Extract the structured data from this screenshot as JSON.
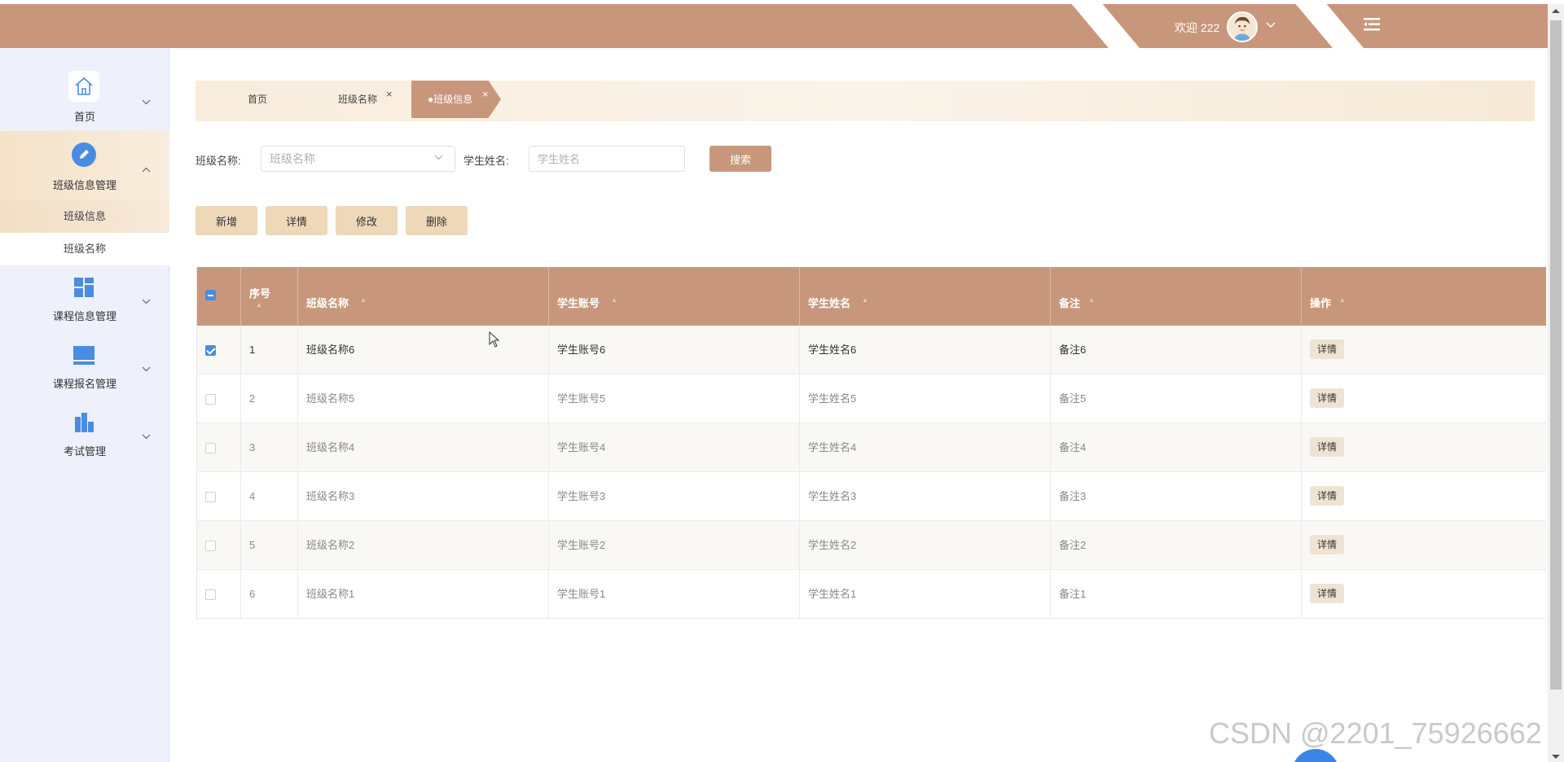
{
  "header": {
    "welcome": "欢迎 222",
    "colors": {
      "brand": "#c8977b",
      "sidebar_bg": "#eef0fc",
      "accent": "#efd8b8"
    }
  },
  "sidebar": {
    "items": [
      {
        "label": "首页",
        "icon": "home-icon"
      },
      {
        "label": "班级信息管理",
        "icon": "edit-icon",
        "expanded": true
      },
      {
        "label": "课程信息管理",
        "icon": "dashboard-icon"
      },
      {
        "label": "课程报名管理",
        "icon": "monitor-icon"
      },
      {
        "label": "考试管理",
        "icon": "chart-icon"
      }
    ],
    "sub_items": [
      {
        "label": "班级信息",
        "active": true
      },
      {
        "label": "班级名称",
        "active": false
      }
    ]
  },
  "breadcrumb": {
    "home": "首页",
    "tab1": "班级名称",
    "tab2": "●班级信息",
    "close": "×"
  },
  "search": {
    "class_label": "班级名称:",
    "class_placeholder": "班级名称",
    "student_label": "学生姓名:",
    "student_placeholder": "学生姓名",
    "search_btn": "搜索"
  },
  "actions": {
    "add": "新增",
    "detail": "详情",
    "edit": "修改",
    "delete": "删除"
  },
  "table": {
    "columns": [
      "序号",
      "班级名称",
      "学生账号",
      "学生姓名",
      "备注",
      "操作"
    ],
    "rows": [
      {
        "checked": true,
        "index": "1",
        "class_name": "班级名称6",
        "account": "学生账号6",
        "student": "学生姓名6",
        "remark": "备注6",
        "op": "详情"
      },
      {
        "checked": false,
        "index": "2",
        "class_name": "班级名称5",
        "account": "学生账号5",
        "student": "学生姓名5",
        "remark": "备注5",
        "op": "详情"
      },
      {
        "checked": false,
        "index": "3",
        "class_name": "班级名称4",
        "account": "学生账号4",
        "student": "学生姓名4",
        "remark": "备注4",
        "op": "详情"
      },
      {
        "checked": false,
        "index": "4",
        "class_name": "班级名称3",
        "account": "学生账号3",
        "student": "学生姓名3",
        "remark": "备注3",
        "op": "详情"
      },
      {
        "checked": false,
        "index": "5",
        "class_name": "班级名称2",
        "account": "学生账号2",
        "student": "学生姓名2",
        "remark": "备注2",
        "op": "详情"
      },
      {
        "checked": false,
        "index": "6",
        "class_name": "班级名称1",
        "account": "学生账号1",
        "student": "学生姓名1",
        "remark": "备注1",
        "op": "详情"
      }
    ]
  },
  "watermark": "CSDN @2201_75926662"
}
